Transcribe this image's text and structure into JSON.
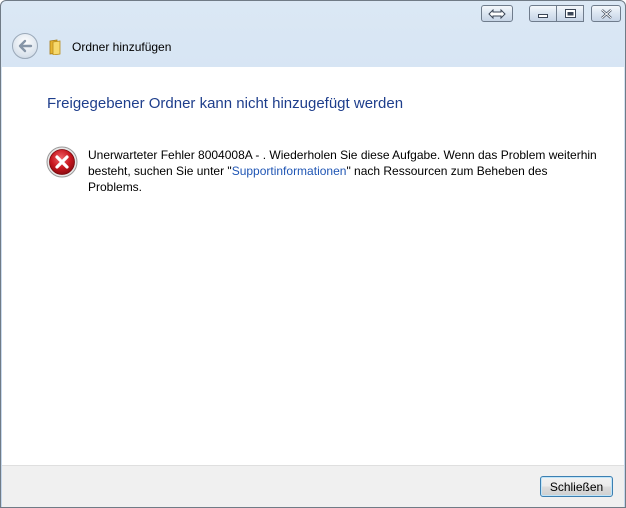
{
  "window": {
    "nav_title": "Ordner hinzufügen"
  },
  "icons": {
    "back": "back-arrow-icon",
    "folder": "folder-icon",
    "error": "error-icon",
    "switch": "switch-windows-icon",
    "minimize": "minimize-icon",
    "maximize": "maximize-icon",
    "close": "close-icon"
  },
  "content": {
    "heading": "Freigegebener Ordner kann nicht hinzugefügt werden",
    "message_before_link": "Unerwarteter Fehler 8004008A - . Wiederholen Sie diese Aufgabe. Wenn das Problem weiterhin besteht, suchen Sie unter \"",
    "link_text": "Supportinformationen",
    "message_after_link": "\" nach Ressourcen zum Beheben des Problems."
  },
  "footer": {
    "close_label": "Schließen"
  },
  "colors": {
    "heading": "#1e3e8c",
    "link": "#1f55b4",
    "error_red": "#c8161e"
  }
}
